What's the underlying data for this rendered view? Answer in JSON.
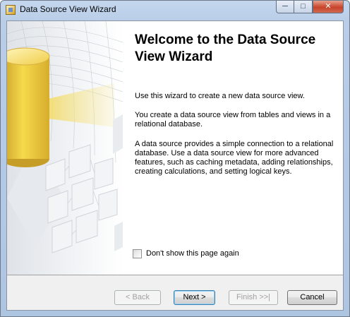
{
  "window": {
    "title": "Data Source View Wizard",
    "controls": {
      "minimize": "─",
      "maximize": "□",
      "close": "✕"
    },
    "icon": "wizard-app-icon"
  },
  "page": {
    "heading": "Welcome to the Data Source View Wizard",
    "paragraphs": [
      "Use this wizard to create a new data source view.",
      "You create a data source view from tables and views in a relational database.",
      "A data source provides a simple connection to a relational database. Use a data source view for more advanced features, such as caching metadata, adding relationships, creating calculations, and setting logical keys."
    ],
    "checkbox": {
      "label": "Don't show this page again",
      "checked": false
    }
  },
  "buttons": {
    "back": "< Back",
    "next": "Next >",
    "finish": "Finish >>|",
    "cancel": "Cancel"
  },
  "colors": {
    "title_bar": "#b9cde8",
    "close_button": "#c7432a",
    "cylinder": "#f2cd3a",
    "dialog_background": "#f0f0f0"
  }
}
